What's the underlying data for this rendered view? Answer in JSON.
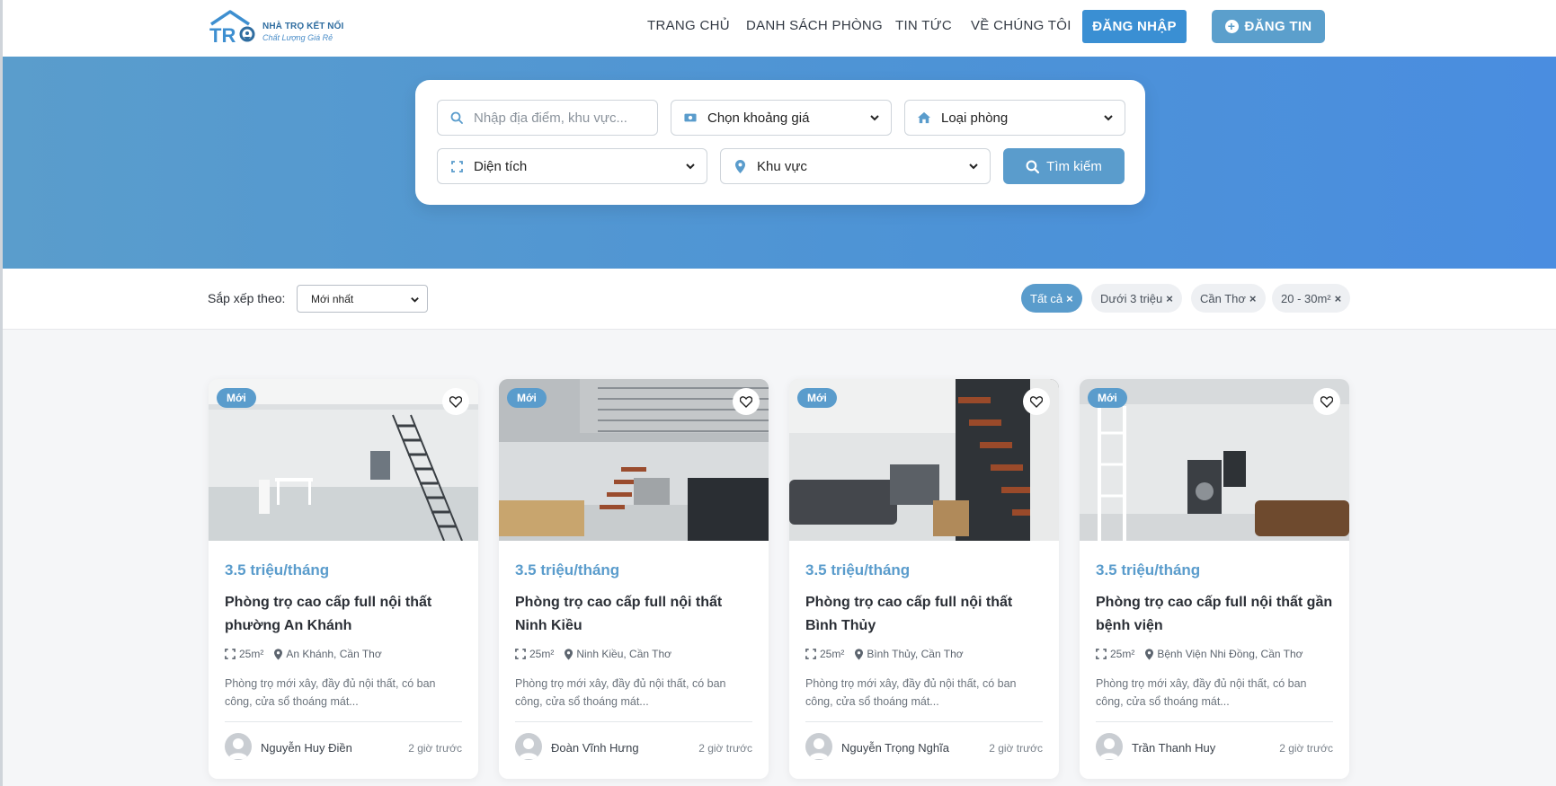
{
  "header": {
    "brand": "NHÀ TRỌ KẾT NỐI",
    "tagline": "Chất Lượng Giá Rẻ",
    "logo_letters": "TR",
    "nav": [
      "TRANG CHỦ",
      "DANH SÁCH PHÒNG",
      "TIN TỨC",
      "VỀ CHÚNG TÔI"
    ],
    "login_label": "ĐĂNG NHẬP",
    "post_label": "ĐĂNG TIN"
  },
  "search": {
    "location_placeholder": "Nhập địa điểm, khu vực...",
    "price_select": "Chọn khoảng giá",
    "type_select": "Loại phòng",
    "area_select": "Diện tích",
    "region_select": "Khu vực",
    "search_label": "Tìm kiếm"
  },
  "filters": {
    "sort_label": "Sắp xếp theo:",
    "sort_value": "Mới nhất",
    "chips": [
      "Tất cả",
      "Dưới 3 triệu",
      "Cần Thơ",
      "20 - 30m²"
    ]
  },
  "cards": [
    {
      "badge": "Mới",
      "price": "3.5 triệu/tháng",
      "title": "Phòng trọ cao cấp full nội thất phường An Khánh",
      "area": "25m²",
      "location": "An Khánh, Cần Thơ",
      "description": "Phòng trọ mới xây, đầy đủ nội thất, có ban công, cửa sổ thoáng mát...",
      "author": "Nguyễn Huy Điền",
      "time": "2 giờ trước"
    },
    {
      "badge": "Mới",
      "price": "3.5 triệu/tháng",
      "title": "Phòng trọ cao cấp full nội thất Ninh Kiều",
      "area": "25m²",
      "location": "Ninh Kiều, Cần Thơ",
      "description": "Phòng trọ mới xây, đầy đủ nội thất, có ban công, cửa sổ thoáng mát...",
      "author": "Đoàn Vĩnh Hưng",
      "time": "2 giờ trước"
    },
    {
      "badge": "Mới",
      "price": "3.5 triệu/tháng",
      "title": "Phòng trọ cao cấp full nội thất Bình Thủy",
      "area": "25m²",
      "location": "Bình Thủy, Cần Thơ",
      "description": "Phòng trọ mới xây, đầy đủ nội thất, có ban công, cửa sổ thoáng mát...",
      "author": "Nguyễn Trọng Nghĩa",
      "time": "2 giờ trước"
    },
    {
      "badge": "Mới",
      "price": "3.5 triệu/tháng",
      "title": "Phòng trọ cao cấp full nội thất gần bệnh viện",
      "area": "25m²",
      "location": "Bệnh Viện Nhi Đồng, Cần Thơ",
      "description": "Phòng trọ mới xây, đầy đủ nội thất, có ban công, cửa sổ thoáng mát...",
      "author": "Trần Thanh Huy",
      "time": "2 giờ trước"
    }
  ],
  "colors": {
    "primary": "#5a9ccc",
    "login": "#3a8fd3",
    "hero_from": "#5a9dcc",
    "hero_to": "#4a8de0"
  },
  "icons": [
    "house-logo-icon",
    "plus-circle-icon",
    "search-icon",
    "money-icon",
    "home-icon",
    "expand-icon",
    "map-pin-icon",
    "heart-icon",
    "user-icon",
    "chevron-down-icon"
  ]
}
